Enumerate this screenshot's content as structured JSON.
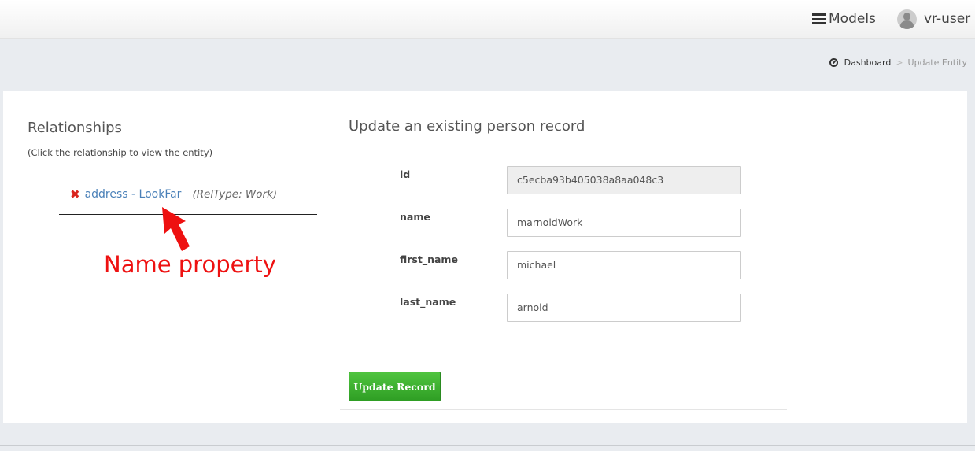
{
  "header": {
    "models_label": "Models",
    "user_name": "vr-user"
  },
  "breadcrumb": {
    "dashboard": "Dashboard",
    "separator": ">",
    "current": "Update Entity"
  },
  "relationships": {
    "title": "Relationships",
    "hint": "(Click the relationship to view the entity)",
    "items": [
      {
        "remove_symbol": "✖",
        "label": "address - LookFar",
        "rel_type": "(RelType: Work)"
      }
    ]
  },
  "annotation": {
    "text": "Name property",
    "color": "#ee1111"
  },
  "form": {
    "title": "Update an existing person record",
    "fields": [
      {
        "label": "id",
        "value": "c5ecba93b405038a8aa048c3",
        "readonly": true
      },
      {
        "label": "name",
        "value": "marnoldWork",
        "readonly": false
      },
      {
        "label": "first_name",
        "value": "michael",
        "readonly": false
      },
      {
        "label": "last_name",
        "value": "arnold",
        "readonly": false
      }
    ],
    "submit_label": "Update Record",
    "submit_color": "#3aad2e"
  },
  "colors": {
    "link": "#4a80b8",
    "remove": "#d9251f",
    "background": "#e9ecf0"
  }
}
